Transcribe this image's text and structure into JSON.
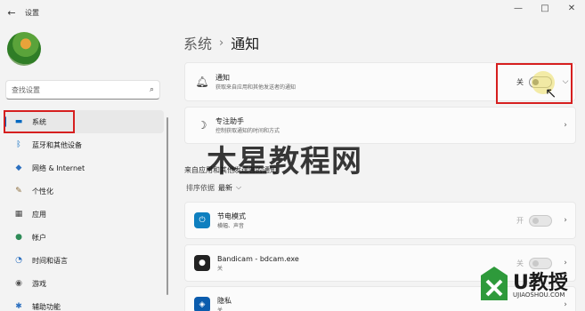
{
  "window": {
    "back_glyph": "←",
    "title": "设置",
    "controls": [
      "—",
      "□",
      "✕"
    ]
  },
  "sidebar": {
    "search_placeholder": "查找设置",
    "items": [
      {
        "label": "系统",
        "icon": "monitor-icon",
        "glyph": "▬",
        "color": "#0067c0",
        "active": true
      },
      {
        "label": "蓝牙和其他设备",
        "icon": "bluetooth-icon",
        "glyph": "ᛒ",
        "color": "#0067c0"
      },
      {
        "label": "网络 & Internet",
        "icon": "wifi-icon",
        "glyph": "◆",
        "color": "#2b6fbf"
      },
      {
        "label": "个性化",
        "icon": "pen-icon",
        "glyph": "✎",
        "color": "#8a6b3a"
      },
      {
        "label": "应用",
        "icon": "apps-icon",
        "glyph": "▦",
        "color": "#444"
      },
      {
        "label": "帐户",
        "icon": "person-icon",
        "glyph": "●",
        "color": "#2e8b57"
      },
      {
        "label": "时间和语言",
        "icon": "clock-icon",
        "glyph": "◔",
        "color": "#2b6fbf"
      },
      {
        "label": "游戏",
        "icon": "gamepad-icon",
        "glyph": "◉",
        "color": "#555"
      },
      {
        "label": "辅助功能",
        "icon": "accessibility-icon",
        "glyph": "✱",
        "color": "#2b6fbf"
      }
    ]
  },
  "main": {
    "breadcrumb": {
      "parent": "系统",
      "separator": "›",
      "current": "通知"
    },
    "notifications": {
      "title": "通知",
      "desc": "获取来自应用和其他发送者的通知",
      "state": "关"
    },
    "focus": {
      "title": "专注助手",
      "desc": "控制获取通知的时间和方式"
    },
    "section_label": "来自应用和其他发送者的通知",
    "sort": {
      "label": "排序依据",
      "value": "最新",
      "chevron": "⌵"
    },
    "apps": [
      {
        "name": "节电模式",
        "sub": "横幅、声音",
        "state": "开",
        "icon": "battery-saver-icon",
        "icon_bg": "#0e7fbf",
        "glyph": "⏻"
      },
      {
        "name": "Bandicam - bdcam.exe",
        "sub": "关",
        "state": "关",
        "icon": "bandicam-icon",
        "icon_bg": "#222",
        "glyph": "●"
      },
      {
        "name": "隐私",
        "sub": "关",
        "state": "",
        "icon": "shield-icon",
        "icon_bg": "#0b5cad",
        "glyph": "◈"
      }
    ]
  },
  "watermark": {
    "text": "木星教程网",
    "logo_text": "U教授",
    "logo_url": "UJIAOSHOU.COM"
  },
  "colors": {
    "accent": "#005fb8",
    "highlight": "#d61f1f"
  }
}
